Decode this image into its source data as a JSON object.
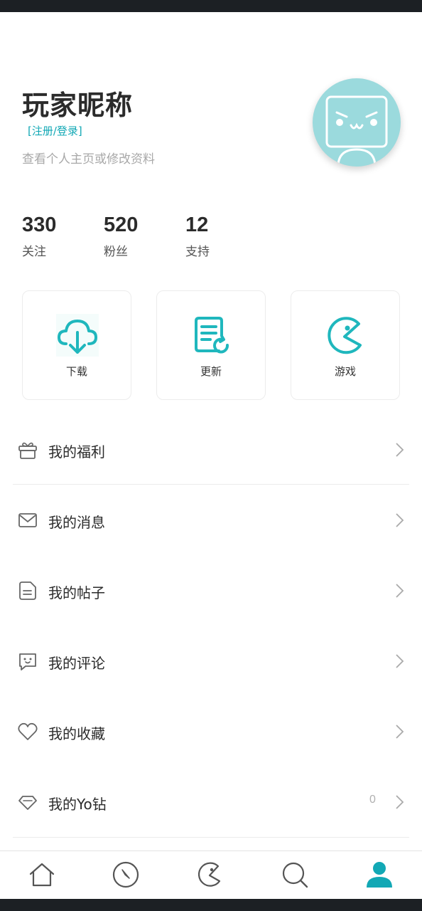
{
  "profile": {
    "nickname": "玩家昵称",
    "login_link": "[注册/登录]",
    "hint": "查看个人主页或修改资料",
    "avatar_color": "#9bdadd"
  },
  "stats": [
    {
      "value": "330",
      "label": "关注"
    },
    {
      "value": "520",
      "label": "粉丝"
    },
    {
      "value": "12",
      "label": "支持"
    }
  ],
  "quick_cards": [
    {
      "label": "下载",
      "icon": "cloud-download-icon"
    },
    {
      "label": "更新",
      "icon": "document-refresh-icon"
    },
    {
      "label": "游戏",
      "icon": "pacman-icon"
    }
  ],
  "menu": [
    {
      "label": "我的福利",
      "icon": "gift-icon"
    },
    {
      "label": "我的消息",
      "icon": "envelope-icon"
    },
    {
      "label": "我的帖子",
      "icon": "document-icon"
    },
    {
      "label": "我的评论",
      "icon": "comment-face-icon"
    },
    {
      "label": "我的收藏",
      "icon": "heart-icon"
    },
    {
      "label": "我的Yo钻",
      "icon": "diamond-icon",
      "count": "0"
    }
  ],
  "tabbar": [
    {
      "name": "home",
      "icon": "home-icon",
      "active": false
    },
    {
      "name": "discover",
      "icon": "compass-icon",
      "active": false
    },
    {
      "name": "games",
      "icon": "pacman-icon",
      "active": false
    },
    {
      "name": "search",
      "icon": "search-icon",
      "active": false
    },
    {
      "name": "profile",
      "icon": "user-icon",
      "active": true
    }
  ],
  "colors": {
    "accent": "#12a8b5",
    "icon_teal": "#1fb7bd",
    "icon_gray": "#555555",
    "active_tab": "#12a8b5"
  }
}
